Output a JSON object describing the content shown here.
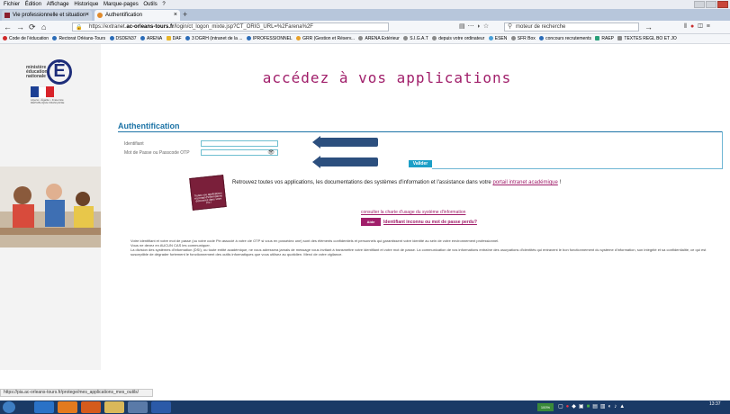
{
  "menu": [
    "Fichier",
    "Édition",
    "Affichage",
    "Historique",
    "Marque-pages",
    "Outils",
    "?"
  ],
  "tabs": [
    {
      "label": "Vie professionnelle et situation"
    },
    {
      "label": "Authentification"
    }
  ],
  "nav": {
    "url_prefix": "https://extranet.",
    "url_domain": "ac-orleans-tours.fr",
    "url_path": "/login/ct_logon_mixte.jsp?CT_ORIG_URL=%2Farena%2F",
    "search_placeholder": "moteur de recherche"
  },
  "bookmarks": [
    "Code de l'éducation",
    "Rectorat Orléans-Tours",
    "DSDEN37",
    "ARENA",
    "DAF",
    "3 DGRH (intranet de la ...",
    "IPROFESSIONNEL",
    "GRR (Gestion et Réserv...",
    "ARENA Extérieur",
    "S.I.G.A.T",
    "depuis votre ordinateur",
    "ESEN",
    "SFR Box",
    "concours recrutements",
    "RAEP",
    "TEXTES REGL BO ET JO"
  ],
  "brand": {
    "ministry_lines": [
      "ministère",
      "éducation",
      "nationale"
    ],
    "logo_letter": "É",
    "flag_caption": "Liberté • Égalité • Fraternité RÉPUBLIQUE FRANÇAISE"
  },
  "page": {
    "title": "accédez à vos applications",
    "auth_title": "Authentification",
    "identifiant_label": "Identifiant",
    "password_label": "Mot de Passe ou Passcode OTP",
    "valider": "Valider",
    "book_label": "Toutes vos applications et portail d'informations découvrez dans votre Pix !",
    "info_text_before": "Retrouvez toutes vos applications, les documentations des systèmes d'information et l'assistance dans votre ",
    "info_link": "portail intranet académique",
    "info_text_after": " !",
    "charte_link": "consulter la charte d'usage du système d'information",
    "help_badge": "Aide",
    "help_link": "Identifiant inconnu ou mot de passe perdu?",
    "disclaimer": [
      "Votre identifiant et votre mot de passe (ou votre code Pin associé à votre clé OTP si vous en possédez une) sont des éléments confidentiels et personnels qui garantissent votre identité au sein de votre environnement professionnel.",
      "Vous ne devez en AUCUN CAS les communiquer.",
      "La division des systèmes d'information (DSI), ou toute entité académique, ne vous adressera jamais de message vous invitant à transmettre votre identifiant et votre mot de passe. La communication de vos informations entraîne des usurpations d'identités qui entravent le bon fonctionnement du système d'information, son intégrité et sa confidentialité, ce qui est susceptible de dégrader fortement le fonctionnement des outils informatiques que vous utilisez au quotidien. Merci de votre vigilance."
    ]
  },
  "status_url": "https://pia.ac-orleans-tours.fr/protege/mes_applications_mes_outils/",
  "taskbar": {
    "tray_badge": "100%",
    "clock_time": "13:37"
  },
  "colors": {
    "brand_magenta": "#a01e6a",
    "auth_blue": "#1c73a6",
    "arrow_navy": "#2c4f7e",
    "valider_cyan": "#1c9fc7",
    "taskbar": "#1a3a66"
  }
}
